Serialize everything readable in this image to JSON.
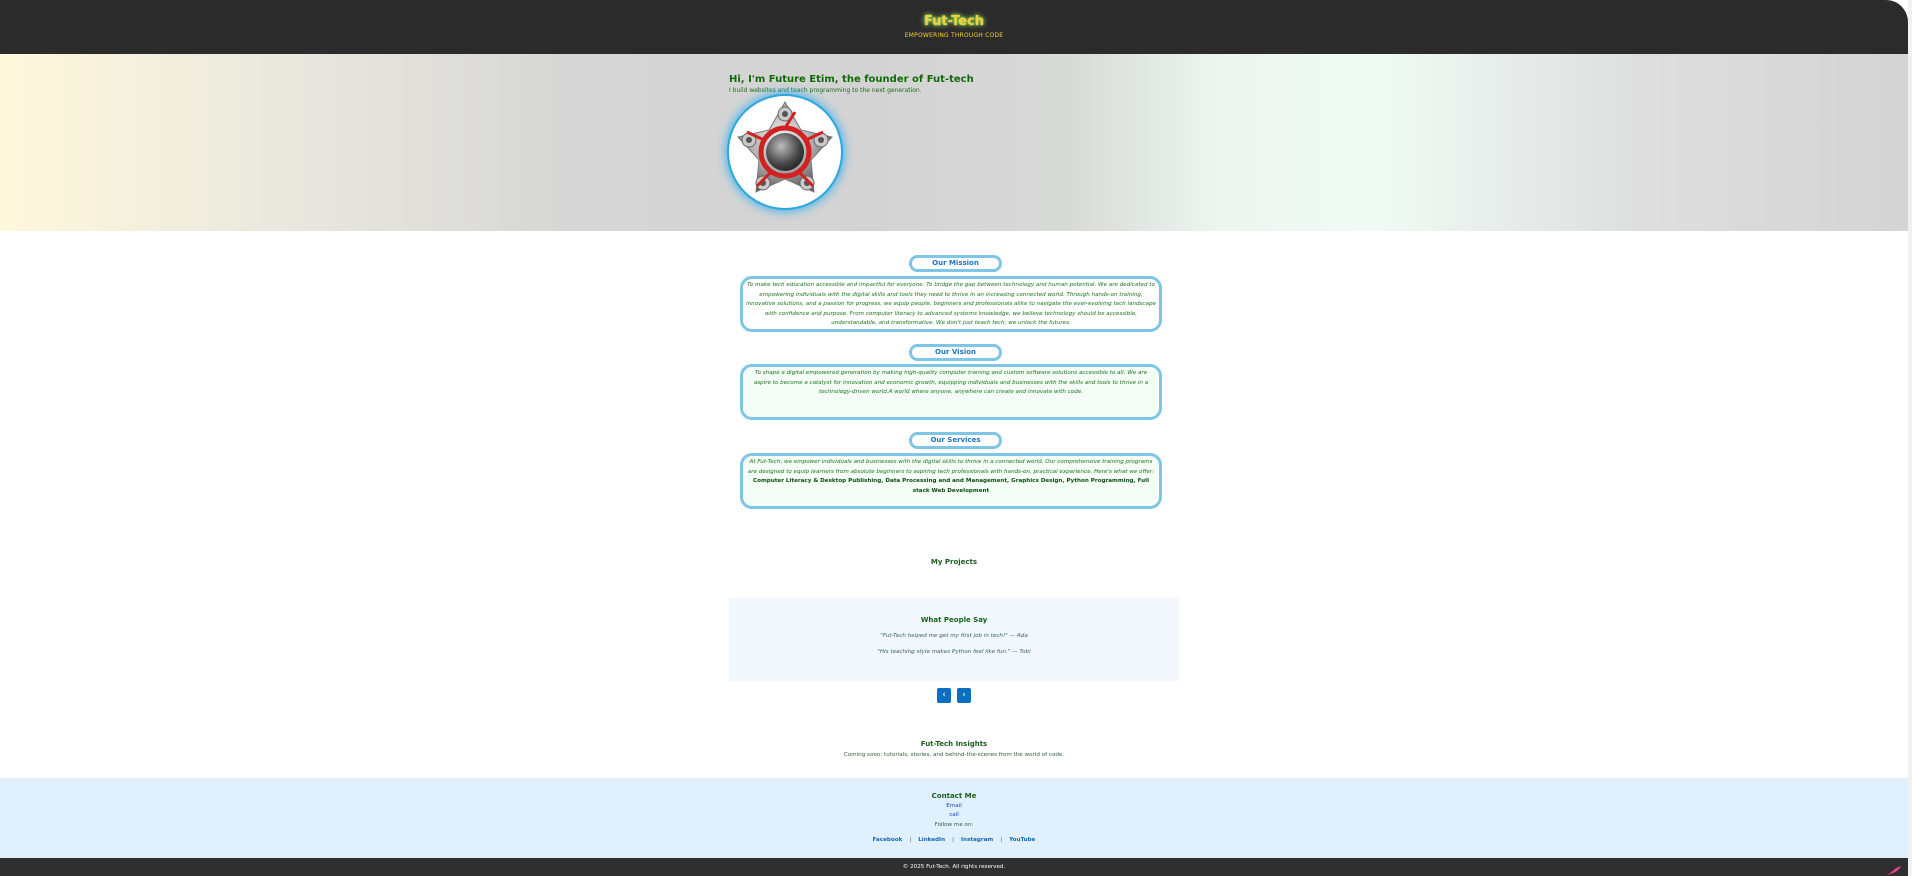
{
  "header": {
    "brand": "Fut-Tech",
    "tagline": "EMPOWERING THROUGH CODE"
  },
  "hero": {
    "title": "Hi, I'm Future Etim, the founder of Fut-tech",
    "subtitle": "I build websites and teach programming to the next generation."
  },
  "mission": {
    "label": "Our Mission",
    "text": "To make tech education accessible and impactful for everyone. To bridge the gap between technology and human potential. We are dedicated to empowering individuals with the digital skills and tools they need to thrive in an increasing connected world. Through hands-on training, innovative solutions, and a passion for progress, we equip people, beginners and professionals alike to navigate the ever-evolving tech landscape with confidence and purpose. From computer literacy to advanced systems knowledge, we believe technology should be accessible, understandable, and transformative. We don't just teach tech; we unlock the futures."
  },
  "vision": {
    "label": "Our Vision",
    "text": "To shape a digital empowered generation by making high-quality computer training and custom software solutions accessible to all. We are aspire to become a catalyst for innovation and economic growth, equipping individuals and businesses with the skills and tools to thrive in a technology-driven world.A world where anyone, anywhere can create and innovate with code."
  },
  "services": {
    "label": "Our Services",
    "text": "At Fut-Tech, we empower individuals and businesses with the digital skills to thrive in a connected world. Our comprehensive training programs are designed to equip learners from absolute beginners to aspiring tech professionals with hands-on, practical experience. Here's what we offer:",
    "highlight": "Computer Literacy & Desktop Publishing, Data Processing and and Management, Graphics Design, Python Programming, Full stack Web Development"
  },
  "projects": {
    "title": "My Projects"
  },
  "testimonials": {
    "title": "What People Say",
    "quotes": [
      "\"Fut-Tech helped me get my first job in tech!\" — Ada",
      "\"His teaching style makes Python feel like fun.\" — Tobi"
    ],
    "prev_label": "‹",
    "next_label": "›"
  },
  "insights": {
    "title": "Fut-Tech Insights",
    "text": "Coming soon: tutorials, stories, and behind-the-scenes from the world of code."
  },
  "contact": {
    "title": "Contact Me",
    "email_label": "Email",
    "call_label": "call",
    "follow_label": "Follow me on:",
    "socials": [
      "Facebook",
      "LinkedIn",
      "Instagram",
      "YouTube"
    ],
    "separator": "|"
  },
  "footer": {
    "copyright": "© 2025 Fut-Tech. All rights reserved."
  },
  "colors": {
    "header_bg": "#2b2b2b",
    "brand": "#f4d13b",
    "accent_border": "#7ec5e6",
    "heading_green": "#106b06",
    "button_blue": "#0a6fc0"
  },
  "icons": {
    "avatar": "gear-logo-image",
    "corner": "quill-icon"
  }
}
